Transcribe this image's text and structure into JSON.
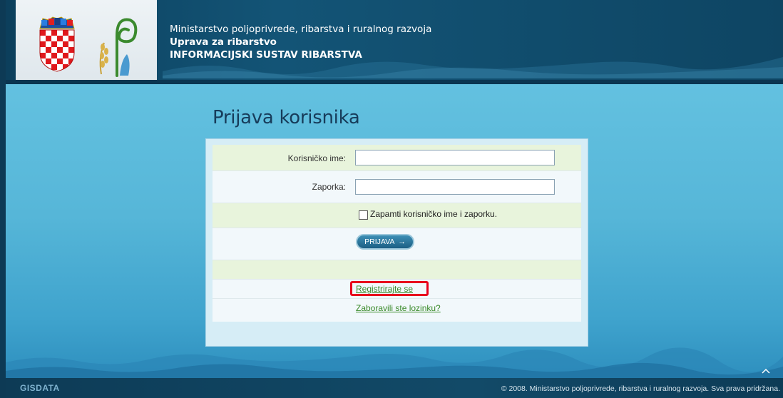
{
  "header": {
    "line1": "Ministarstvo poljoprivrede, ribarstva i ruralnog razvoja",
    "line2": "Uprava za ribarstvo",
    "line3": "INFORMACIJSKI SUSTAV RIBARSTVA",
    "coat_of_arms_icon": "croatian-coat-of-arms-icon",
    "fisheries_logo_icon": "fisheries-logo-icon"
  },
  "login": {
    "title": "Prijava korisnika",
    "username_label": "Korisničko ime:",
    "username_value": "",
    "password_label": "Zaporka:",
    "password_value": "",
    "remember_label": "Zapamti korisničko ime i zaporku.",
    "submit_label": "PRIJAVA",
    "submit_arrow": "→",
    "register_link": "Registrirajte se",
    "forgot_link": "Zaboravili ste lozinku?"
  },
  "footer": {
    "brand": "GISDATA",
    "copyright": "© 2008. Ministarstvo poljoprivrede, ribarstva i ruralnog razvoja. Sva prava pridržana."
  },
  "colors": {
    "header_bg": "#135476",
    "main_bg": "#56b6d8",
    "link": "#3a8a2a",
    "highlight": "#e8001c"
  }
}
